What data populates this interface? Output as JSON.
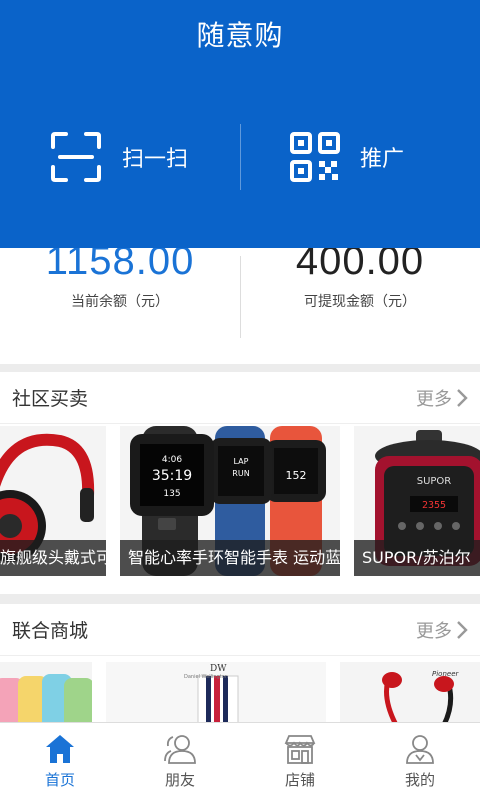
{
  "header": {
    "title": "随意购",
    "scan_label": "扫一扫",
    "promote_label": "推广"
  },
  "balance": {
    "current_amount": "1158.00",
    "current_caption": "当前余额（元）",
    "withdrawable_amount": "400.00",
    "withdrawable_caption": "可提现金额（元）"
  },
  "community": {
    "title": "社区买卖",
    "more_label": "更多",
    "items": [
      {
        "caption": "旗舰级头戴式可折"
      },
      {
        "caption": "智能心率手环智能手表 运动蓝牙"
      },
      {
        "caption": "SUPOR/苏泊尔"
      }
    ]
  },
  "mall": {
    "title": "联合商城",
    "more_label": "更多",
    "items": [
      {
        "caption": ""
      },
      {
        "caption": "",
        "brand": "DW",
        "brand_sub": "Daniel Wellington"
      },
      {
        "caption": ""
      },
      {
        "caption": "",
        "brand": "Pioneer"
      }
    ]
  },
  "tabbar": {
    "tabs": [
      {
        "label": "首页",
        "icon": "home-icon"
      },
      {
        "label": "朋友",
        "icon": "friends-icon"
      },
      {
        "label": "店铺",
        "icon": "store-icon"
      },
      {
        "label": "我的",
        "icon": "profile-icon"
      }
    ]
  },
  "colors": {
    "header_blue": "#0a63c9",
    "active_blue": "#1a73d6"
  }
}
